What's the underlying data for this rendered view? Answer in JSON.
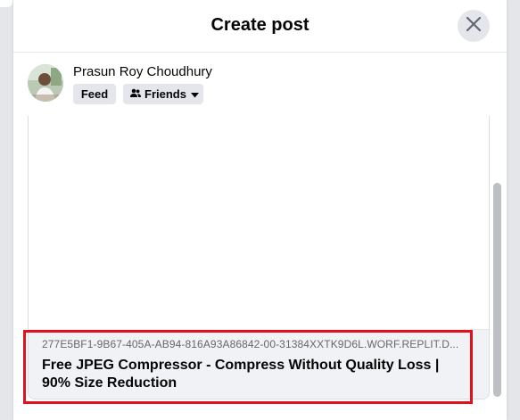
{
  "dialog": {
    "title": "Create post",
    "close_icon": "close-icon"
  },
  "user": {
    "name": "Prasun Roy Choudhury",
    "avatar_icon": "avatar"
  },
  "audience": {
    "feed_label": "Feed",
    "friends_label": "Friends",
    "friends_icon": "friends-icon",
    "caret_icon": "caret-down-icon"
  },
  "link_preview": {
    "domain": "277E5BF1-9B67-405A-AB94-816A93A86842-00-31384XXTK9D6L.WORF.REPLIT.D...",
    "title": "Free JPEG Compressor - Compress Without Quality Loss | 90% Size Reduction"
  },
  "colors": {
    "highlight": "#e0121c",
    "chip_bg": "#e4e6eb",
    "card_bg": "#f0f2f5"
  }
}
